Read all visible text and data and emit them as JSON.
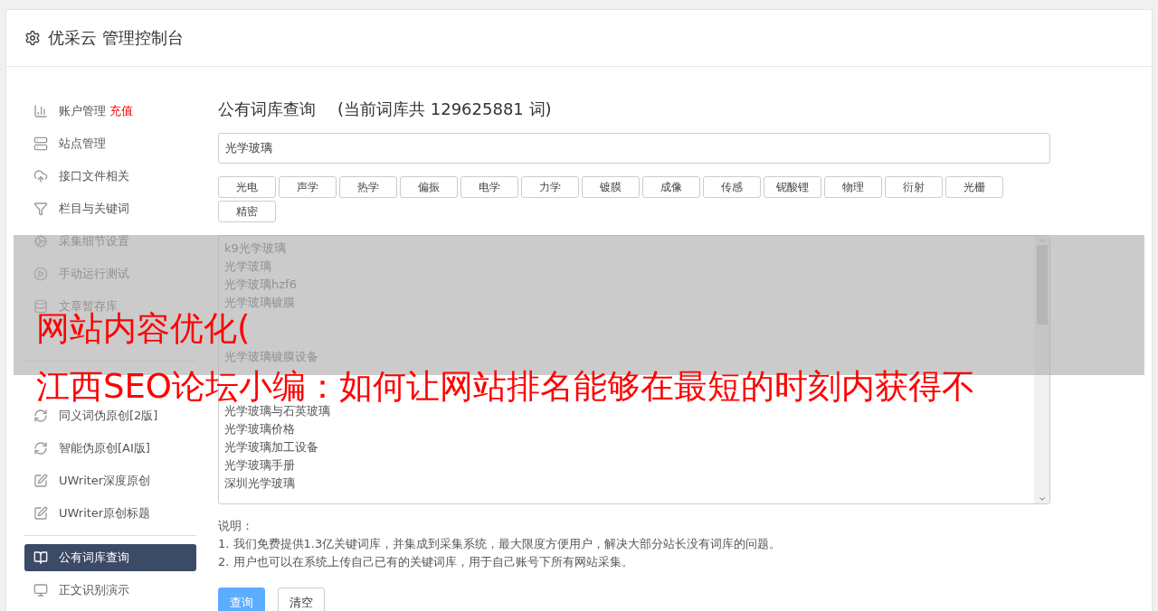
{
  "header": {
    "title": "优采云 管理控制台"
  },
  "sidebar": {
    "groups": [
      {
        "items": [
          {
            "label": "账户管理",
            "badge": "充值",
            "kind": "chart",
            "selected": false
          },
          {
            "label": "站点管理",
            "kind": "server",
            "selected": false
          },
          {
            "label": "接口文件相关",
            "kind": "cloud",
            "selected": false
          },
          {
            "label": "栏目与关键词",
            "kind": "filter",
            "selected": false
          },
          {
            "label": "采集细节设置",
            "kind": "cogs",
            "selected": false
          },
          {
            "label": "手动运行测试",
            "kind": "play",
            "selected": false
          },
          {
            "label": "文章暂存库",
            "kind": "database",
            "selected": false
          },
          {
            "kind": "covered",
            "selected": false
          }
        ]
      },
      {
        "items": [
          {
            "kind": "covered",
            "selected": false
          },
          {
            "label": "同义词伪原创[2版]",
            "kind": "refresh",
            "selected": false
          },
          {
            "label": "智能伪原创[AI版]",
            "kind": "refresh",
            "selected": false
          },
          {
            "label": "UWriter深度原创",
            "kind": "edit",
            "selected": false
          },
          {
            "label": "UWriter原创标题",
            "kind": "edit",
            "selected": false
          }
        ]
      },
      {
        "items": [
          {
            "label": "公有词库查询",
            "kind": "book",
            "selected": true
          },
          {
            "label": "正文识别演示",
            "kind": "monitor",
            "selected": false
          }
        ]
      }
    ]
  },
  "main": {
    "title": "公有词库查询",
    "subtitle": "(当前词库共 129625881 词)",
    "search": {
      "value": "光学玻璃"
    },
    "tags": [
      "光电",
      "声学",
      "热学",
      "偏振",
      "电学",
      "力学",
      "镀膜",
      "成像",
      "传感",
      "铌酸锂",
      "物理",
      "衍射",
      "光栅",
      "精密"
    ],
    "results": [
      {
        "kind": "text",
        "text": "k9光学玻璃"
      },
      {
        "kind": "text",
        "text": "光学玻璃"
      },
      {
        "kind": "text",
        "text": "光学玻璃hzf6"
      },
      {
        "kind": "text",
        "text": "光学玻璃镀膜"
      },
      {
        "kind": "covered"
      },
      {
        "kind": "covered"
      },
      {
        "kind": "text",
        "text": "光学玻璃镀膜设备"
      },
      {
        "kind": "covered"
      },
      {
        "kind": "covered"
      },
      {
        "kind": "text",
        "text": "光学玻璃与石英玻璃"
      },
      {
        "kind": "text",
        "text": "光学玻璃价格"
      },
      {
        "kind": "text",
        "text": "光学玻璃加工设备"
      },
      {
        "kind": "text",
        "text": "光学玻璃手册"
      },
      {
        "kind": "text",
        "text": "深圳光学玻璃"
      }
    ],
    "notes": {
      "heading": "说明：",
      "lines": [
        "1. 我们免费提供1.3亿关键词库，并集成到采集系统，最大限度方便用户，解决大部分站长没有词库的问题。",
        "2. 用户也可以在系统上传自己已有的关键词库，用于自己账号下所有网站采集。"
      ]
    },
    "buttons": [
      {
        "label": "查询",
        "kind": "primary"
      },
      {
        "label": "清空",
        "kind": "default"
      }
    ]
  },
  "overlay": {
    "lines": [
      "网站内容优化(",
      "江西SEO论坛小编：如何让网站排名能够在最短的时刻内获得不"
    ]
  }
}
